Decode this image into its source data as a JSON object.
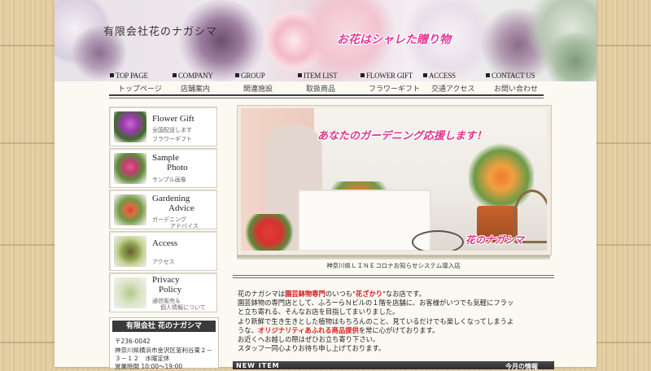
{
  "header": {
    "company": "有限会社花のナガシマ",
    "tagline": "お花はシャレた贈り物"
  },
  "nav": [
    {
      "en": "TOP PAGE",
      "jp": "トップページ"
    },
    {
      "en": "COMPANY",
      "jp": "店舗案内"
    },
    {
      "en": "GROUP",
      "jp": "関連施設"
    },
    {
      "en": "ITEM LIST",
      "jp": "取扱商品"
    },
    {
      "en": "FLOWER GIFT",
      "jp": "フラワーギフト"
    },
    {
      "en": "ACCESS",
      "jp": "交通アクセス"
    },
    {
      "en": "CONTACT US",
      "jp": "お問い合わせ"
    }
  ],
  "sidebar": {
    "buttons": [
      {
        "title": "Flower Gift",
        "sub1": "全国配送します",
        "sub2": "フラワーギフト"
      },
      {
        "title1": "Sample",
        "title2": "Photo",
        "sub": "サンプル画像"
      },
      {
        "title1": "Gardening",
        "title2": "Advice",
        "sub1": "ガーデニング",
        "sub2": "アドバイス"
      },
      {
        "title": "Access",
        "sub": "アクセス"
      },
      {
        "title1": "Privacy",
        "title2": "Policy",
        "sub1": "通信販売＆",
        "sub2": "個人情報について"
      }
    ],
    "company_box": {
      "heading": "有限会社 花のナガシマ",
      "postal": "〒236-0042",
      "address1": "神奈川県横浜市金沢区釜利谷東２－",
      "address2": "３－１２　水曜定休",
      "hours": "営業時間 10:00～19:00"
    }
  },
  "hero": {
    "title": "あなたのガーデニング応援します！",
    "logo": "花のナガシマ"
  },
  "notice": "神奈川県ＬＩＮＥコロナお知らせシステム導入店",
  "intro": {
    "line1_a": "花のナガシマは",
    "line1_red": "園芸鉢物専門",
    "line1_b": "のいつも\"",
    "line1_red2": "花ざかり",
    "line1_c": "\"なお店です。",
    "line2": "園芸鉢物の専門店として、ふろーらＮビルの１階を店舗に、お客様がいつでも気軽にフラッ",
    "line3": "と立ち寄れる、そんなお店を目指してまいりました。",
    "line4": "より新鮮で生き生きとした植物はもちろんのこと、見ているだけでも楽しくなってしまうよ",
    "line5_a": "うな、",
    "line5_red": "オリジナリティあふれる商品提供",
    "line5_b": "を常に心がけております。",
    "line6": "お近くへお越しの際はぜひお立ち寄り下さい。",
    "line7": "スタッフ一同心よりお待ち申し上げております。"
  },
  "news": {
    "label": "NEW ITEM",
    "right": "今月の情報"
  }
}
